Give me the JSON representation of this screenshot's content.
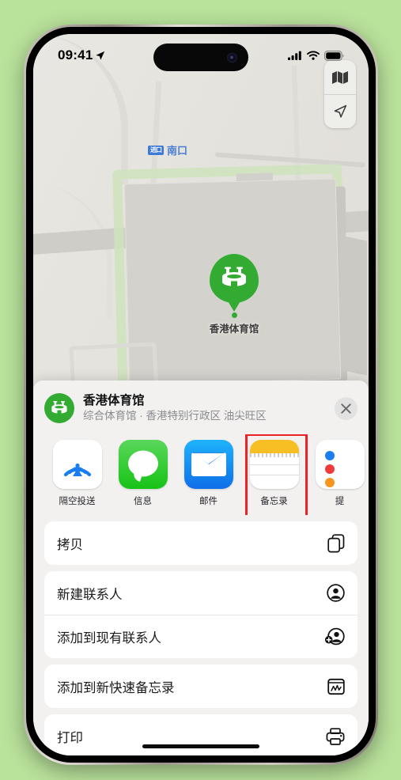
{
  "statusbar": {
    "time": "09:41",
    "location_arrow_icon": "location-arrow-icon",
    "cellular_icon": "cellular-bars-icon",
    "wifi_icon": "wifi-icon",
    "battery_icon": "battery-full-icon"
  },
  "map": {
    "entrance_badge": "进口",
    "entrance_label": "南口",
    "poi_label": "香港体育馆",
    "controls": [
      {
        "name": "map-type-button",
        "icon": "folded-map-icon"
      },
      {
        "name": "locate-me-button",
        "icon": "location-arrow-icon"
      }
    ]
  },
  "sheet": {
    "title": "香港体育馆",
    "subtitle": "综合体育馆 · 香港特别行政区 油尖旺区",
    "close_label": "✕",
    "apps": [
      {
        "label": "隔空投送",
        "icon": "airdrop-icon",
        "highlighted": false
      },
      {
        "label": "信息",
        "icon": "messages-icon",
        "highlighted": false
      },
      {
        "label": "邮件",
        "icon": "mail-icon",
        "highlighted": false
      },
      {
        "label": "备忘录",
        "icon": "notes-icon",
        "highlighted": true
      },
      {
        "label": "提",
        "icon": "reminders-icon",
        "highlighted": false
      }
    ],
    "groups": [
      {
        "rows": [
          {
            "label": "拷贝",
            "icon": "copy-doc-icon"
          }
        ]
      },
      {
        "rows": [
          {
            "label": "新建联系人",
            "icon": "person-circle-icon"
          },
          {
            "label": "添加到现有联系人",
            "icon": "person-badge-plus-icon"
          }
        ]
      },
      {
        "rows": [
          {
            "label": "添加到新快速备忘录",
            "icon": "quick-note-icon"
          }
        ]
      },
      {
        "rows": [
          {
            "label": "打印",
            "icon": "printer-icon"
          }
        ]
      }
    ]
  },
  "colors": {
    "background": "#b9e29b",
    "poi_green": "#33ab33",
    "highlight_red": "#ee2222",
    "link_blue": "#3d79d8"
  }
}
